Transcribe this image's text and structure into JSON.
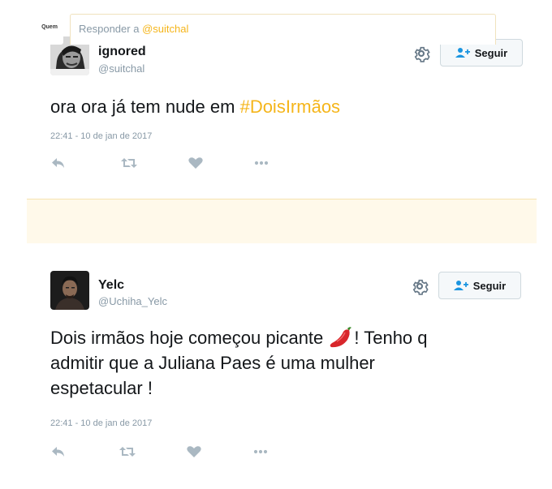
{
  "tweets": [
    {
      "name": "ignored",
      "handle": "@suitchal",
      "follow_label": "Seguir",
      "text_prefix": "ora ora já tem nude em ",
      "hashtag": "#DoisIrmãos",
      "timestamp": "22:41 - 10 de jan de 2017"
    },
    {
      "name": "Yelc",
      "handle": "@Uchiha_Yelc",
      "follow_label": "Seguir",
      "text_line1_before": "Dois irmãos hoje começou picante ",
      "text_line1_after": "! Tenho q",
      "text_line2": "admitir que a Juliana Paes é uma mulher",
      "text_line3": "espetacular !",
      "timestamp": "22:41 - 10 de jan de 2017"
    }
  ],
  "reply": {
    "avatar_label": "Quem",
    "prompt": "Responder a ",
    "mention": "@suitchal"
  },
  "icons": [
    "reply-icon",
    "retweet-icon",
    "like-icon",
    "more-icon",
    "gear-icon",
    "follow-person-icon",
    "chili-pepper-icon"
  ],
  "colors": {
    "accent": "#f5b51a",
    "meta": "#8899a6",
    "text": "#14171a"
  }
}
